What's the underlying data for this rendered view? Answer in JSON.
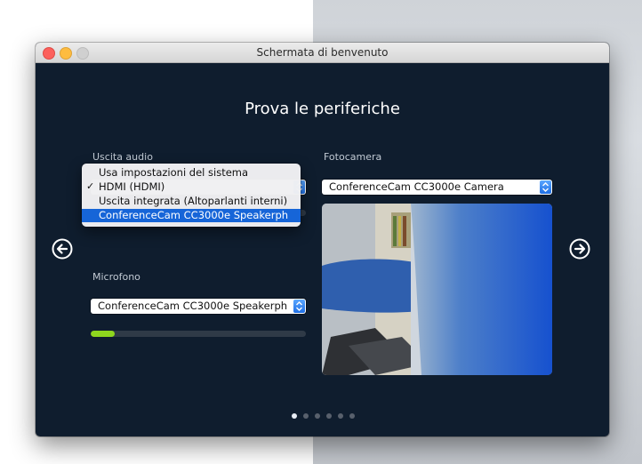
{
  "window": {
    "title": "Schermata di benvenuto"
  },
  "heading": "Prova le periferiche",
  "audio_output": {
    "label": "Uscita audio",
    "menu_items": [
      {
        "label": "Usa impostazioni del sistema",
        "checked": false,
        "highlighted": false
      },
      {
        "label": "HDMI (HDMI)",
        "checked": true,
        "highlighted": false
      },
      {
        "label": "Uscita integrata (Altoparlanti interni)",
        "checked": false,
        "highlighted": false
      },
      {
        "label": "ConferenceCam CC3000e Speakerph",
        "checked": false,
        "highlighted": true
      }
    ],
    "check_glyph": "✓"
  },
  "microphone": {
    "label": "Microfono",
    "selected": "ConferenceCam CC3000e Speakerph",
    "level_fraction": 0.11
  },
  "camera": {
    "label": "Fotocamera",
    "selected": "ConferenceCam CC3000e Camera"
  },
  "navigation": {
    "back_icon": "arrow-left-circle-icon",
    "forward_icon": "arrow-right-circle-icon"
  },
  "pagination": {
    "count": 6,
    "active_index": 0
  },
  "colors": {
    "accent": "#1665d8",
    "level": "#8ed61e",
    "background": "#0f1d2e"
  }
}
